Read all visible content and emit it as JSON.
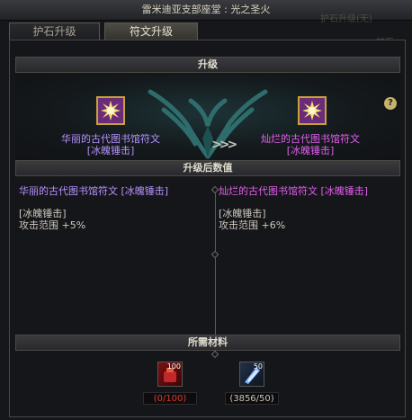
{
  "window": {
    "title": "雷米迪亚支部座堂 : 光之圣火"
  },
  "background_text": {
    "ghost1": "护石升级(无)",
    "ghost2": "护石",
    "ghost3": "护石"
  },
  "tabs": [
    {
      "label": "护石升级"
    },
    {
      "label": "符文升级"
    }
  ],
  "sections": {
    "upgrade": "升级",
    "after": "升级后数值",
    "materials": "所需材料"
  },
  "upgrade": {
    "from": {
      "name_line1": "华丽的古代图书馆符文",
      "name_line2": "[冰魄锤击]"
    },
    "to": {
      "name_line1": "灿烂的古代图书馆符文",
      "name_line2": "[冰魄锤击]"
    },
    "arrow": ">>>"
  },
  "compare": {
    "left": {
      "title": "华丽的古代图书馆符文 [冰魄锤击]",
      "skill": "[冰魄锤击]",
      "stat": "攻击范围 +5%"
    },
    "right": {
      "title": "灿烂的古代图书馆符文 [冰魄锤击]",
      "skill": "[冰魄锤击]",
      "stat": "攻击范围 +6%"
    }
  },
  "materials": [
    {
      "icon": "red-material-icon",
      "badge": "100",
      "count": "(0/100)",
      "color": "#e23a2a"
    },
    {
      "icon": "blue-crystal-icon",
      "badge": "50",
      "count": "(3856/50)",
      "color": "#c9c4b6"
    }
  ],
  "help": "?"
}
